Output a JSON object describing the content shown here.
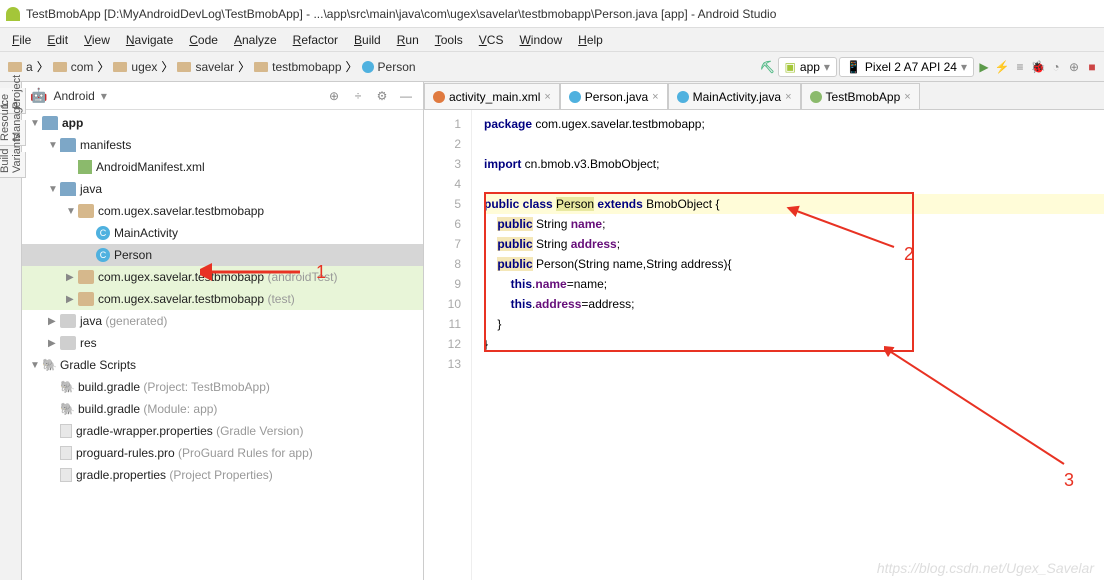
{
  "window": {
    "title": "TestBmobApp [D:\\MyAndroidDevLog\\TestBmobApp] - ...\\app\\src\\main\\java\\com\\ugex\\savelar\\testbmobapp\\Person.java [app] - Android Studio"
  },
  "menu": [
    "File",
    "Edit",
    "View",
    "Navigate",
    "Code",
    "Analyze",
    "Refactor",
    "Build",
    "Run",
    "Tools",
    "VCS",
    "Window",
    "Help"
  ],
  "breadcrumb": [
    {
      "icon": "pkg",
      "label": "a"
    },
    {
      "icon": "pkg",
      "label": "com"
    },
    {
      "icon": "pkg",
      "label": "ugex"
    },
    {
      "icon": "pkg",
      "label": "savelar"
    },
    {
      "icon": "pkg",
      "label": "testbmobapp"
    },
    {
      "icon": "cls",
      "label": "Person"
    }
  ],
  "runconfig": {
    "module": "app",
    "device": "Pixel 2 A7 API 24"
  },
  "sideTabs": [
    "1: Project",
    "Resource Manager",
    "Build Variants"
  ],
  "project": {
    "mode": "Android",
    "tree": [
      {
        "d": 0,
        "arr": "▼",
        "ico": "folder",
        "lbl": "app",
        "bold": true
      },
      {
        "d": 1,
        "arr": "▼",
        "ico": "folder",
        "lbl": "manifests"
      },
      {
        "d": 2,
        "arr": " ",
        "ico": "mf",
        "lbl": "AndroidManifest.xml"
      },
      {
        "d": 1,
        "arr": "▼",
        "ico": "folder",
        "lbl": "java"
      },
      {
        "d": 2,
        "arr": "▼",
        "ico": "pkg",
        "lbl": "com.ugex.savelar.testbmobapp"
      },
      {
        "d": 3,
        "arr": " ",
        "ico": "class",
        "lbl": "MainActivity"
      },
      {
        "d": 3,
        "arr": " ",
        "ico": "class",
        "lbl": "Person",
        "sel": true
      },
      {
        "d": 2,
        "arr": "▶",
        "ico": "pkg",
        "lbl": "com.ugex.savelar.testbmobapp",
        "dim": " (androidTest)",
        "green": true
      },
      {
        "d": 2,
        "arr": "▶",
        "ico": "pkg",
        "lbl": "com.ugex.savelar.testbmobapp",
        "dim": " (test)",
        "green": true
      },
      {
        "d": 1,
        "arr": "▶",
        "ico": "folderg",
        "lbl": "java",
        "dim": " (generated)"
      },
      {
        "d": 1,
        "arr": "▶",
        "ico": "folderg",
        "lbl": "res"
      },
      {
        "d": 0,
        "arr": "▼",
        "ico": "grdl",
        "lbl": "Gradle Scripts",
        "bold": false
      },
      {
        "d": 1,
        "arr": " ",
        "ico": "grdl",
        "lbl": "build.gradle",
        "dim": " (Project: TestBmobApp)"
      },
      {
        "d": 1,
        "arr": " ",
        "ico": "grdl",
        "lbl": "build.gradle",
        "dim": " (Module: app)"
      },
      {
        "d": 1,
        "arr": " ",
        "ico": "file",
        "lbl": "gradle-wrapper.properties",
        "dim": " (Gradle Version)"
      },
      {
        "d": 1,
        "arr": " ",
        "ico": "file",
        "lbl": "proguard-rules.pro",
        "dim": " (ProGuard Rules for app)"
      },
      {
        "d": 1,
        "arr": " ",
        "ico": "file",
        "lbl": "gradle.properties",
        "dim": " (Project Properties)"
      }
    ]
  },
  "editor": {
    "tabs": [
      {
        "label": "activity_main.xml",
        "color": "#e07a3f",
        "active": false
      },
      {
        "label": "Person.java",
        "color": "#4fb1df",
        "active": true
      },
      {
        "label": "MainActivity.java",
        "color": "#4fb1df",
        "active": false
      },
      {
        "label": "TestBmobApp",
        "color": "#8bba6c",
        "active": false
      }
    ],
    "code": {
      "lines": [
        {
          "n": 1,
          "html": "<span class='pkw'>package</span> com.ugex.savelar.testbmobapp;"
        },
        {
          "n": 2,
          "html": ""
        },
        {
          "n": 3,
          "html": "<span class='pkw'>import</span> cn.bmob.v3.BmobObject;"
        },
        {
          "n": 4,
          "html": ""
        },
        {
          "n": 5,
          "html": "<span class='pkw'>public class</span> <span class='hlclass'>Person</span> <span class='pkw'>extends</span> BmobObject {",
          "hl": true
        },
        {
          "n": 6,
          "html": "    <span class='pkw pubhl'>public</span> String <span class='str'>name</span>;"
        },
        {
          "n": 7,
          "html": "    <span class='pkw pubhl'>public</span> String <span class='str'>address</span>;"
        },
        {
          "n": 8,
          "html": "    <span class='pkw pubhl'>public</span> Person(String name,String address){"
        },
        {
          "n": 9,
          "html": "        <span class='pkw'>this</span>.<span class='str'>name</span>=name;"
        },
        {
          "n": 10,
          "html": "        <span class='pkw'>this</span>.<span class='str'>address</span>=address;"
        },
        {
          "n": 11,
          "html": "    }"
        },
        {
          "n": 12,
          "html": "}"
        },
        {
          "n": 13,
          "html": ""
        }
      ]
    }
  },
  "annotations": {
    "n1": "1",
    "n2": "2",
    "n3": "3"
  },
  "watermark": "https://blog.csdn.net/Ugex_Savelar"
}
